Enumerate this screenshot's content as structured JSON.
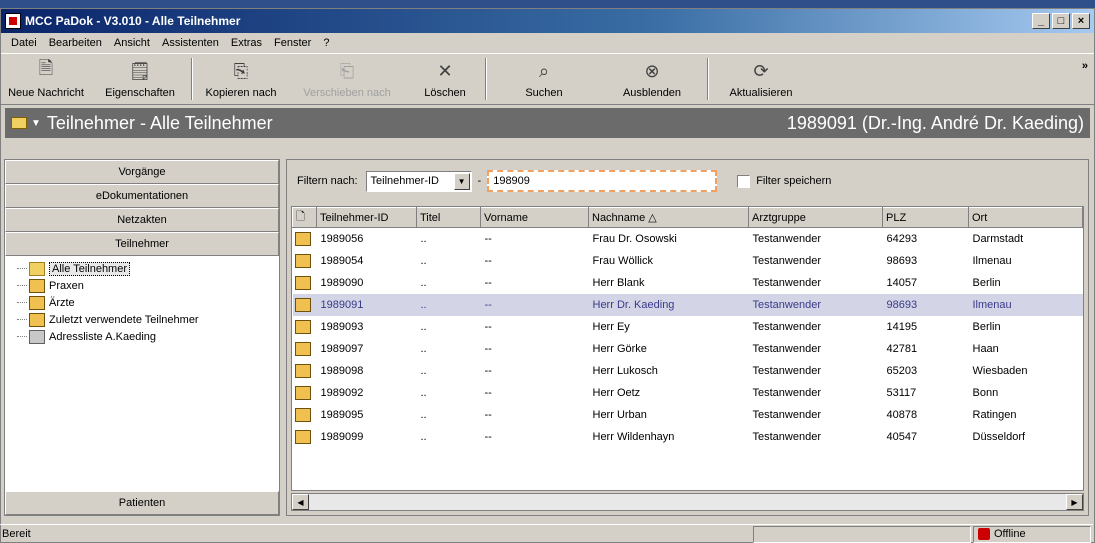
{
  "window": {
    "title": "MCC PaDok - V3.010 - Alle Teilnehmer"
  },
  "menu": [
    "Datei",
    "Bearbeiten",
    "Ansicht",
    "Assistenten",
    "Extras",
    "Fenster",
    "?"
  ],
  "toolbar": {
    "buttons": [
      {
        "label": "Neue Nachricht",
        "icon": "new-message-icon"
      },
      {
        "label": "Eigenschaften",
        "icon": "properties-icon"
      },
      {
        "label": "Kopieren nach",
        "icon": "copy-to-icon"
      },
      {
        "label": "Verschieben nach",
        "icon": "move-to-icon",
        "disabled": true
      },
      {
        "label": "Löschen",
        "icon": "delete-icon"
      },
      {
        "label": "Suchen",
        "icon": "search-icon"
      },
      {
        "label": "Ausblenden",
        "icon": "hide-icon"
      },
      {
        "label": "Aktualisieren",
        "icon": "refresh-icon"
      }
    ],
    "more": "»"
  },
  "header": {
    "title": "Teilnehmer - Alle Teilnehmer",
    "user": "1989091 (Dr.-Ing. André Dr. Kaeding)"
  },
  "nav": {
    "buttons": [
      "Vorgänge",
      "eDokumentationen",
      "Netzakten",
      "Teilnehmer"
    ],
    "tree": [
      "Alle Teilnehmer",
      "Praxen",
      "Ärzte",
      "Zuletzt verwendete Teilnehmer",
      "Adressliste A.Kaeding"
    ],
    "bottom": "Patienten"
  },
  "filter": {
    "label": "Filtern nach:",
    "field": "Teilnehmer-ID",
    "dash": "-",
    "value": "198909",
    "save_label": "Filter speichern"
  },
  "table": {
    "columns": [
      "Teilnehmer-ID",
      "Titel",
      "Vorname",
      "Nachname",
      "Arztgruppe",
      "PLZ",
      "Ort"
    ],
    "rows": [
      [
        "1989056",
        "..",
        "--",
        "Frau Dr. Osowski",
        "Testanwender",
        "64293",
        "Darmstadt"
      ],
      [
        "1989054",
        "..",
        "--",
        "Frau Wöllick",
        "Testanwender",
        "98693",
        "Ilmenau"
      ],
      [
        "1989090",
        "..",
        "--",
        "Herr Blank",
        "Testanwender",
        "14057",
        "Berlin"
      ],
      [
        "1989091",
        "..",
        "--",
        "Herr Dr. Kaeding",
        "Testanwender",
        "98693",
        "Ilmenau"
      ],
      [
        "1989093",
        "..",
        "--",
        "Herr Ey",
        "Testanwender",
        "14195",
        "Berlin"
      ],
      [
        "1989097",
        "..",
        "--",
        "Herr Görke",
        "Testanwender",
        "42781",
        "Haan"
      ],
      [
        "1989098",
        "..",
        "--",
        "Herr Lukosch",
        "Testanwender",
        "65203",
        "Wiesbaden"
      ],
      [
        "1989092",
        "..",
        "--",
        "Herr Oetz",
        "Testanwender",
        "53117",
        "Bonn"
      ],
      [
        "1989095",
        "..",
        "--",
        "Herr Urban",
        "Testanwender",
        "40878",
        "Ratingen"
      ],
      [
        "1989099",
        "..",
        "--",
        "Herr Wildenhayn",
        "Testanwender",
        "40547",
        "Düsseldorf"
      ]
    ],
    "selected_index": 3
  },
  "status": {
    "text": "Bereit",
    "offline": "Offline"
  }
}
